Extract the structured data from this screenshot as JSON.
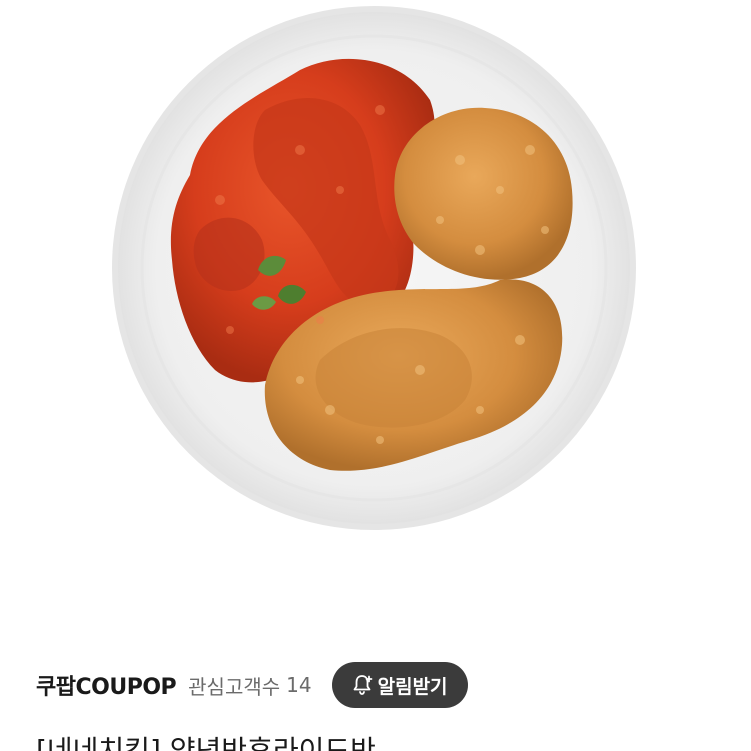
{
  "product": {
    "image_alt": "chicken-plate-photo"
  },
  "seller": {
    "name": "쿠팝COUPOP",
    "follower_label": "관심고객수",
    "follower_count": "14",
    "notify_label": "알림받기"
  },
  "title": {
    "text": "[네네치킨] 양념반후라이드반"
  },
  "colors": {
    "button_bg": "#3b3b3b",
    "seller_text": "#1a1a1a",
    "muted_text": "#6b6b6b"
  },
  "icons": {
    "notify": "bell-plus-icon"
  }
}
